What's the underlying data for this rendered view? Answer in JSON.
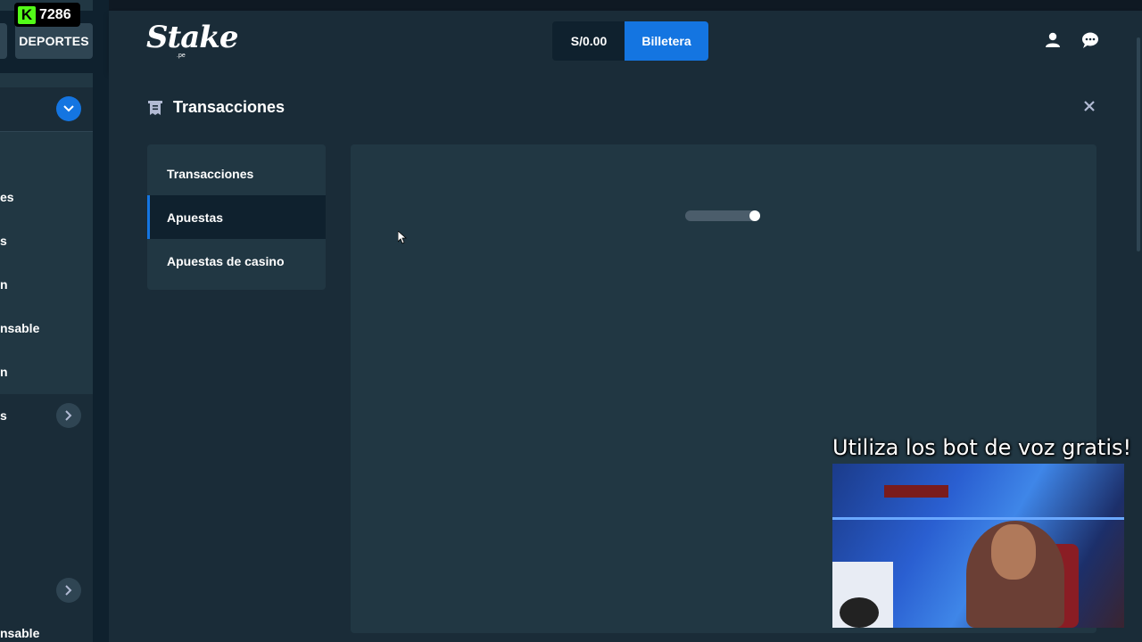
{
  "overlay": {
    "viewer_count": "7286",
    "caption": "Utiliza los bot de voz gratis!"
  },
  "sidebar": {
    "sports_label": "DEPORTES",
    "partial_items": [
      "es",
      "s",
      "n",
      "nsable",
      "n",
      "s",
      "nsable"
    ]
  },
  "header": {
    "logo": "Stake",
    "logo_sub": ".pe",
    "balance": "S/0.00",
    "wallet_label": "Billetera"
  },
  "modal": {
    "title": "Transacciones",
    "menu": [
      {
        "label": "Transacciones",
        "active": false
      },
      {
        "label": "Apuestas",
        "active": true
      },
      {
        "label": "Apuestas de casino",
        "active": false
      }
    ]
  },
  "colors": {
    "accent": "#1475e1",
    "background": "#1a2c38",
    "panel": "#213743",
    "dark": "#0f212e"
  }
}
